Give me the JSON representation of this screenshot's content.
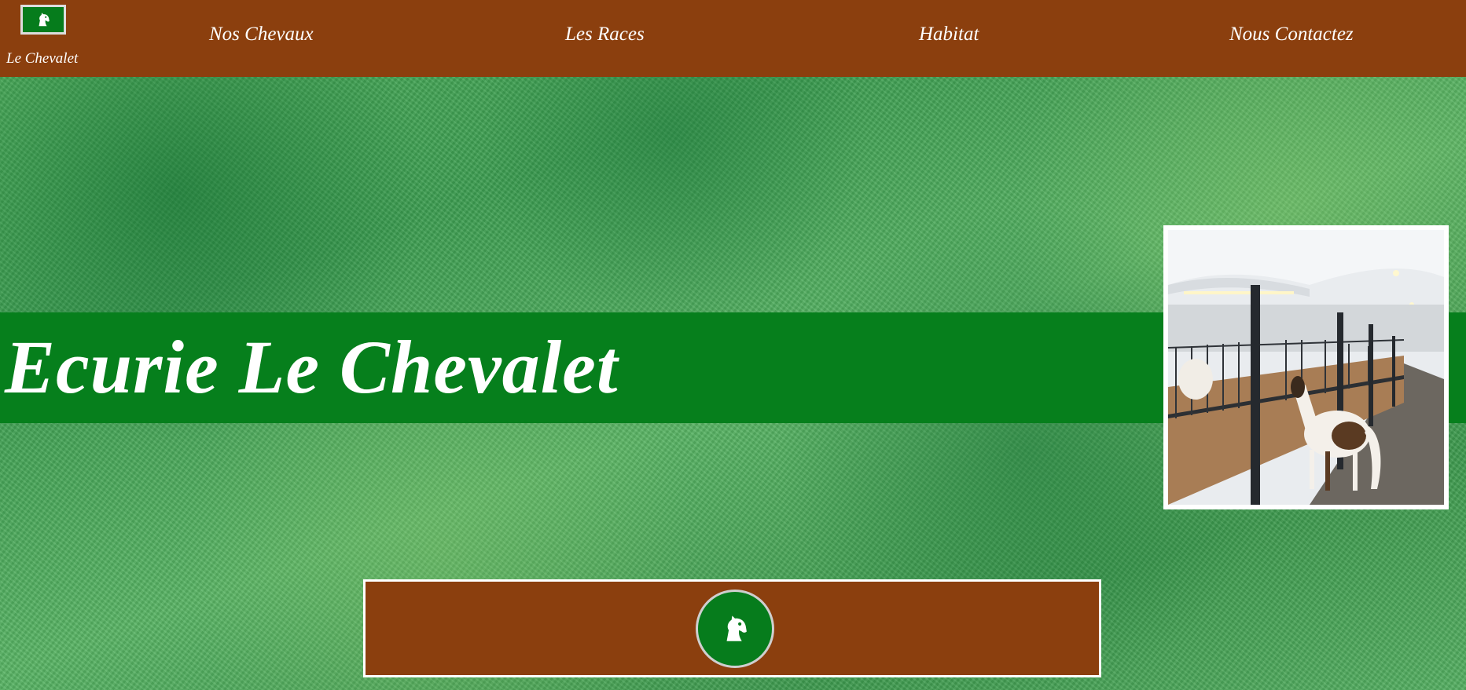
{
  "brand": {
    "name": "Le Chevalet",
    "logo_icon": "horse-head-icon"
  },
  "nav": {
    "items": [
      {
        "label": "Nos Chevaux"
      },
      {
        "label": "Les Races"
      },
      {
        "label": "Habitat"
      },
      {
        "label": "Nous Contactez"
      }
    ]
  },
  "hero": {
    "title": "Ecurie Le Chevalet"
  },
  "footer": {
    "logo_icon": "horse-head-icon"
  },
  "colors": {
    "nav_background": "#8b3f0e",
    "brand_green": "#067f1c",
    "text": "#ffffff"
  }
}
